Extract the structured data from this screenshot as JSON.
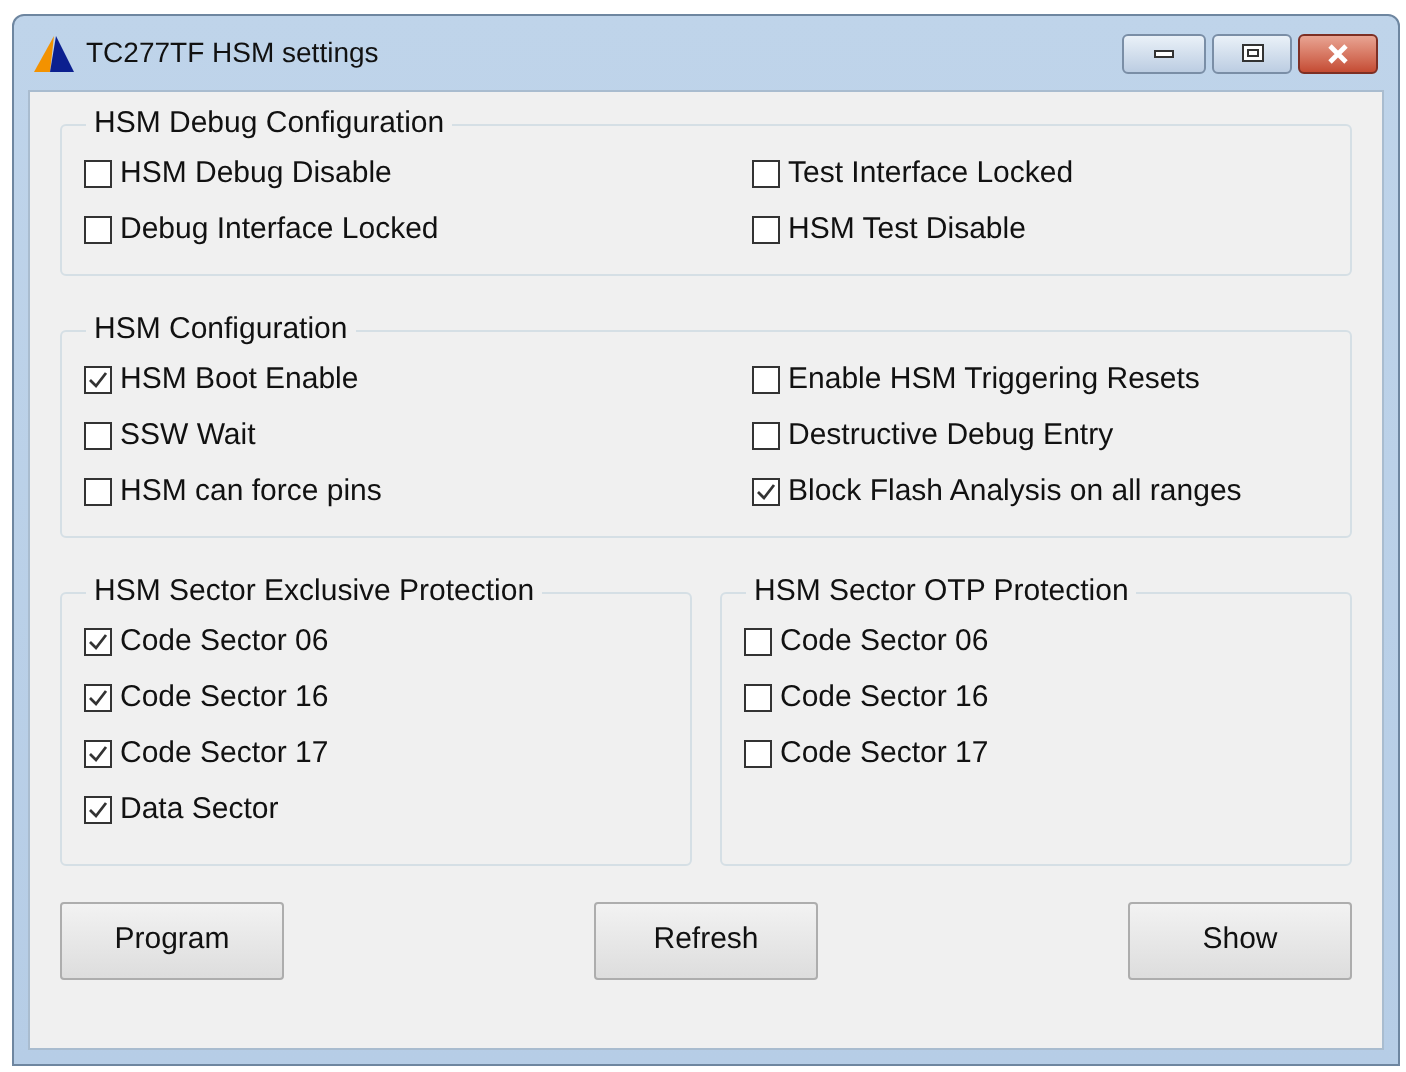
{
  "window": {
    "title": "TC277TF HSM settings"
  },
  "sections": [
    {
      "title": "HSM Debug Configuration",
      "columns": [
        [
          {
            "label": "HSM Debug Disable",
            "checked": false
          },
          {
            "label": "Debug Interface Locked",
            "checked": false
          }
        ],
        [
          {
            "label": "Test Interface Locked",
            "checked": false
          },
          {
            "label": "HSM Test Disable",
            "checked": false
          }
        ]
      ]
    },
    {
      "title": "HSM Configuration",
      "columns": [
        [
          {
            "label": "HSM Boot Enable",
            "checked": true
          },
          {
            "label": "SSW Wait",
            "checked": false
          },
          {
            "label": "HSM can force pins",
            "checked": false
          }
        ],
        [
          {
            "label": "Enable HSM Triggering Resets",
            "checked": false
          },
          {
            "label": "Destructive Debug Entry",
            "checked": false
          },
          {
            "label": "Block Flash Analysis on all ranges",
            "checked": true
          }
        ]
      ]
    }
  ],
  "sector_groups": [
    {
      "title": "HSM Sector Exclusive Protection",
      "items": [
        {
          "label": "Code Sector 06",
          "checked": true
        },
        {
          "label": "Code Sector 16",
          "checked": true
        },
        {
          "label": "Code Sector 17",
          "checked": true
        },
        {
          "label": "Data Sector",
          "checked": true
        }
      ]
    },
    {
      "title": "HSM Sector OTP Protection",
      "items": [
        {
          "label": "Code Sector 06",
          "checked": false
        },
        {
          "label": "Code Sector 16",
          "checked": false
        },
        {
          "label": "Code Sector 17",
          "checked": false
        }
      ]
    }
  ],
  "buttons": [
    "Program",
    "Refresh",
    "Show"
  ]
}
